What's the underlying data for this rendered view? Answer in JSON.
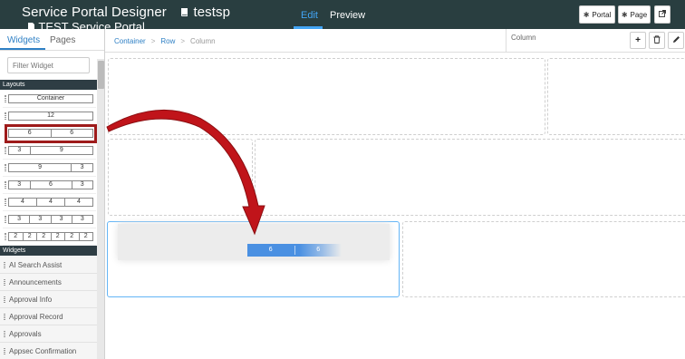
{
  "header": {
    "app_title": "Service Portal Designer",
    "portal_name": "testsp",
    "portal_subtitle": "TEST Service Portal",
    "tabs": [
      {
        "label": "Edit",
        "active": true
      },
      {
        "label": "Preview",
        "active": false
      }
    ],
    "buttons": {
      "portal": "Portal",
      "page": "Page"
    }
  },
  "sidebar": {
    "tabs": [
      {
        "label": "Widgets",
        "active": true
      },
      {
        "label": "Pages",
        "active": false
      }
    ],
    "filter_placeholder": "Filter Widget",
    "layouts_header": "Layouts",
    "layouts": [
      [
        "Container"
      ],
      [
        "12"
      ],
      [
        "6",
        "6"
      ],
      [
        "3",
        "9"
      ],
      [
        "9",
        "3"
      ],
      [
        "3",
        "6",
        "3"
      ],
      [
        "4",
        "4",
        "4"
      ],
      [
        "3",
        "3",
        "3",
        "3"
      ],
      [
        "2",
        "2",
        "2",
        "2",
        "2",
        "2"
      ]
    ],
    "highlighted_layout": [
      "6",
      "6"
    ],
    "widgets_header": "Widgets",
    "widgets": [
      "AI Search Assist",
      "Announcements",
      "Approval Info",
      "Approval Record",
      "Approvals",
      "Appsec Confirmation"
    ]
  },
  "breadcrumb": {
    "items": [
      "Container",
      "Row",
      "Column"
    ]
  },
  "context_panel": {
    "label": "Column"
  },
  "drag_preview": {
    "cells": [
      "6",
      "6"
    ]
  },
  "colors": {
    "topbar": "#293e40",
    "accent": "#42a5f5",
    "highlight_border": "#9e1b1b",
    "arrow": "#c0141a",
    "drop_active": "#64b5f6"
  },
  "icons": [
    "book-icon",
    "document-icon",
    "gear-icon",
    "external-link-icon",
    "plus-icon",
    "trash-icon",
    "pencil-icon",
    "drag-arrow"
  ]
}
